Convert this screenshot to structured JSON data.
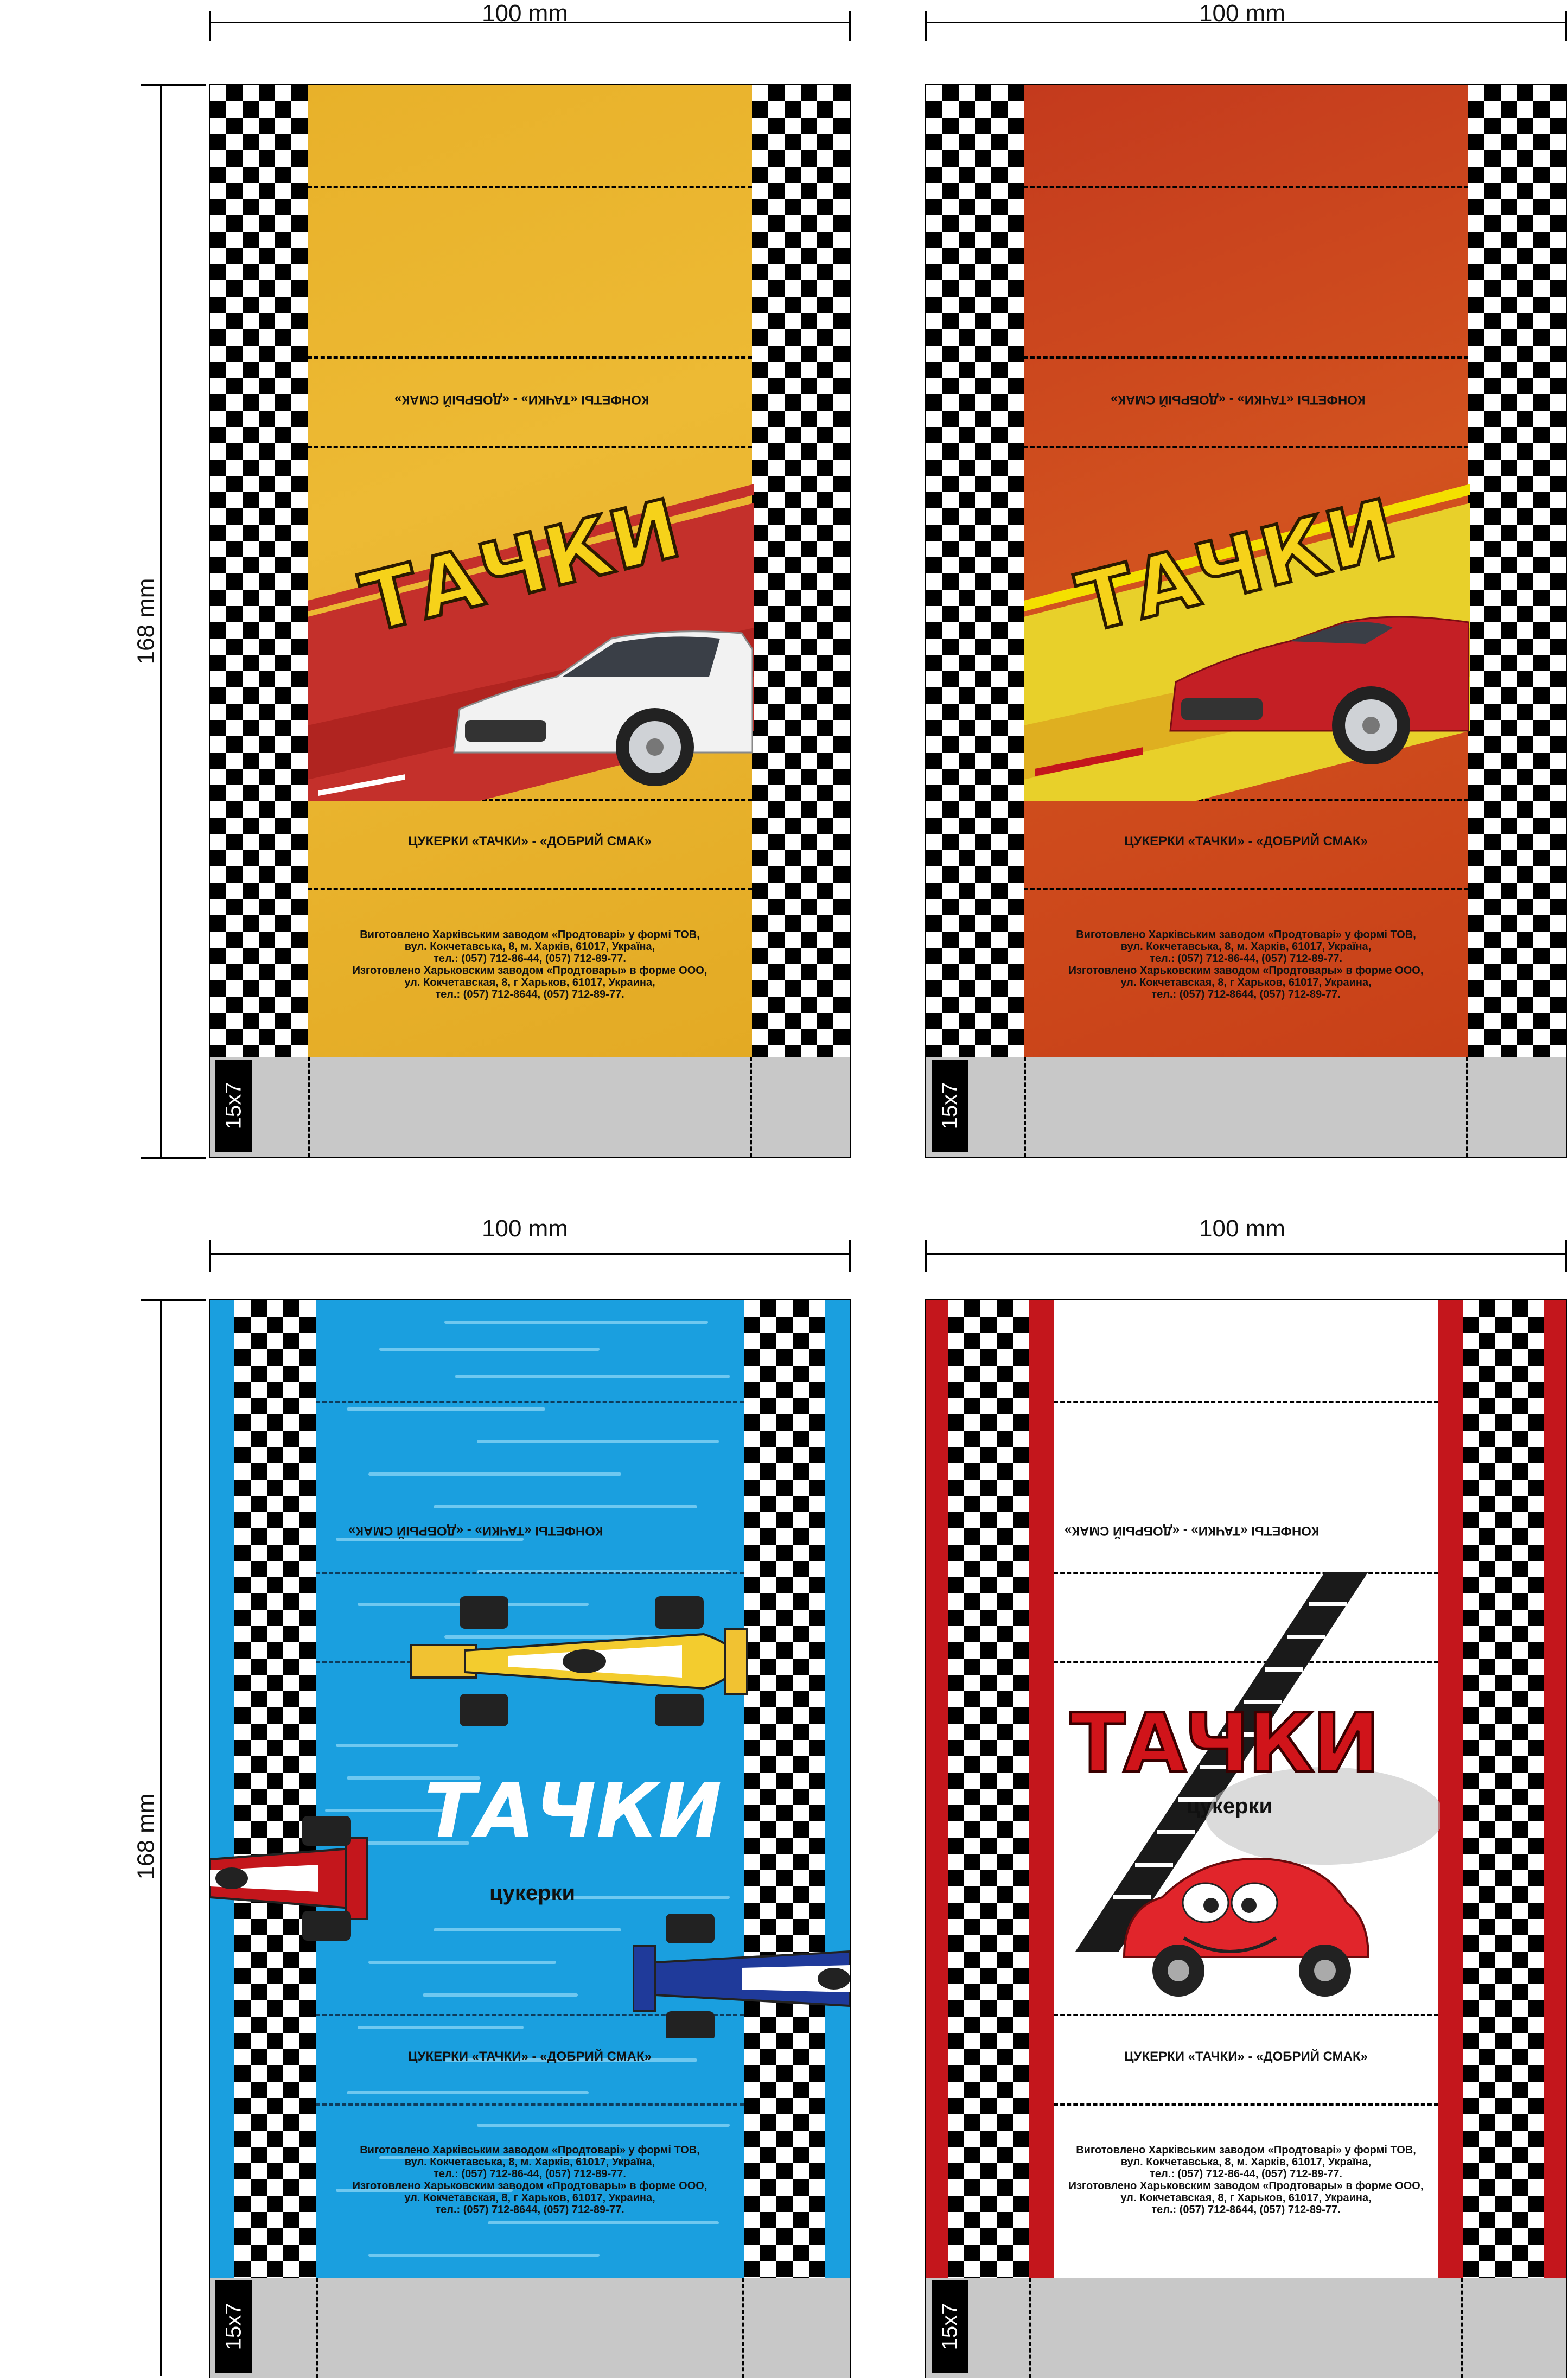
{
  "dimensions": {
    "width_label": "100 mm",
    "height_label": "168 mm"
  },
  "size_tag": "15x7",
  "top_caption": "КОНФЕТЫ «ТАЧКИ» - «ДОБРЫЙ СМАК»",
  "product_caption": "ЦУКЕРКИ «ТАЧКИ» - «ДОБРИЙ СМАК»",
  "brand": "ТАЧКИ",
  "subtitle": "цукерки",
  "maker_lines": [
    "Виготовлено Харківським заводом «Продтоварі» у формі ТОВ,",
    "вул. Кокчетавська, 8, м. Харків, 61017, Україна,",
    "тел.: (057) 712-86-44, (057) 712-89-77.",
    "Изготовлено Харьковским заводом «Продтовары» в форме ООО,",
    "ул. Кокчетавская, 8, г Харьков, 61017, Украина,",
    "тел.: (057) 712-8644, (057) 712-89-77."
  ],
  "colors": {
    "yellow": "#e9b52b",
    "orange_red": "#cf4a1e",
    "blue": "#1a9fdf",
    "white": "#ffffff",
    "red": "#c4161c",
    "strip_gray": "#c8c8c8"
  }
}
